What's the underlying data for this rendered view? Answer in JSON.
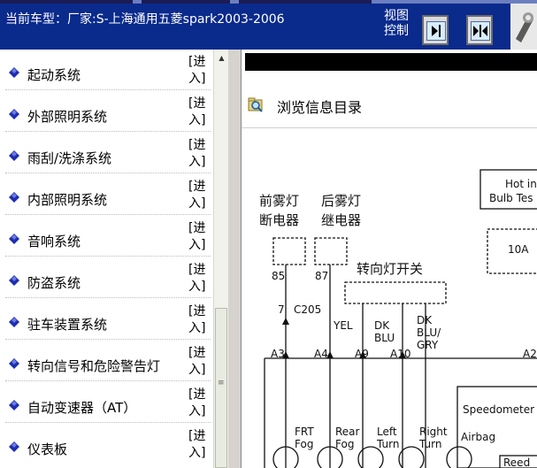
{
  "header": {
    "car_info": "当前车型：厂家:S-上海通用五菱spark2003-2006",
    "view_control": "视图控制"
  },
  "menu": {
    "enter_label": "[进入]",
    "items": [
      {
        "label": "起动系统"
      },
      {
        "label": "外部照明系统"
      },
      {
        "label": "雨刮/洗涤系统"
      },
      {
        "label": "内部照明系统"
      },
      {
        "label": "音响系统"
      },
      {
        "label": "防盗系统"
      },
      {
        "label": "驻车装置系统"
      },
      {
        "label": "转向信号和危险警告灯"
      },
      {
        "label": "自动变速器（AT）"
      },
      {
        "label": "仪表板"
      }
    ]
  },
  "content": {
    "toc_label": "浏览信息目录"
  },
  "diagram": {
    "front_fog_relay": [
      "前雾灯",
      "断电器"
    ],
    "rear_fog_relay": [
      "后雾灯",
      "继电器"
    ],
    "turn_switch": "转向灯开关",
    "hot_box": [
      "Hot in",
      "Bulb Tes"
    ],
    "fuse": "10A",
    "pins": [
      "85",
      "87"
    ],
    "connector": "7",
    "connector_name": "C205",
    "wires": [
      "YEL",
      "DK",
      "BLU",
      "DK",
      "BLU/",
      "GRY"
    ],
    "terminals": [
      "A3",
      "A4",
      "A9",
      "A10",
      "A2"
    ],
    "lamps": [
      [
        "FRT",
        "Fog"
      ],
      [
        "Rear",
        "Fog"
      ],
      [
        "Left",
        "Turn"
      ],
      [
        "Right",
        "Turn"
      ],
      [
        "Airbag"
      ]
    ],
    "speedometer": "Speedometer",
    "reed": "Reed"
  }
}
